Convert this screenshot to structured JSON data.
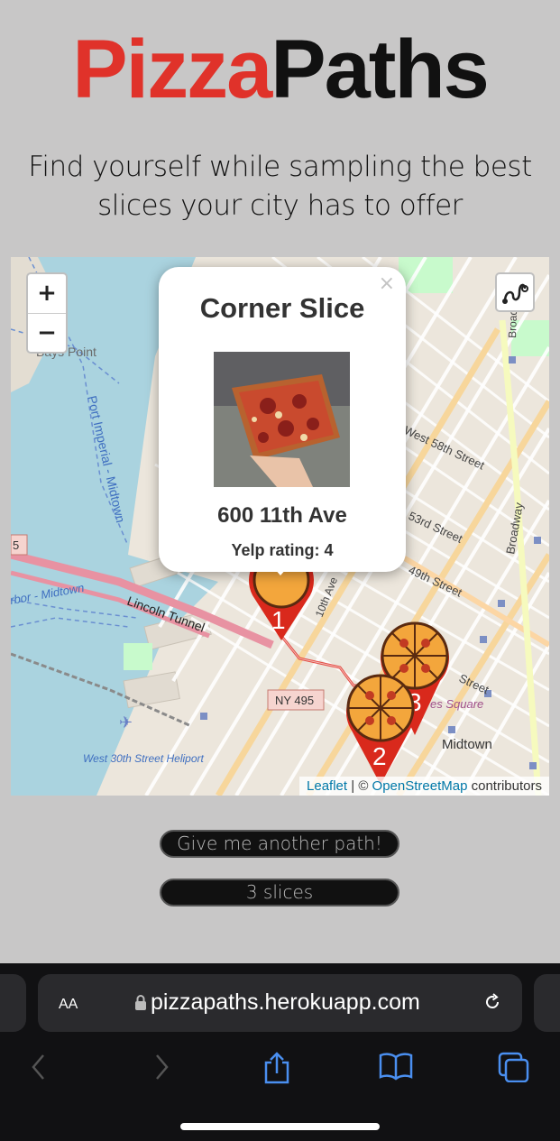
{
  "header": {
    "title_part1": "Pizza",
    "title_part2": "Paths",
    "tagline": "Find yourself while sampling the best slices your city has to offer"
  },
  "map": {
    "zoom_in": "+",
    "zoom_out": "−",
    "labels": {
      "port_imperial": "Port Imperial - Midtown",
      "bays_point": "Bays Point",
      "lincoln_tunnel": "Lincoln Tunnel",
      "ny495": "NY 495",
      "west_58th": "West 58th Street",
      "w53rd": "53rd Street",
      "w49th": "49th Street",
      "broadway": "Broadway",
      "broad": "Broad",
      "midtown": "Midtown",
      "times_square": "es Square",
      "heliport": "West 30th Street Heliport",
      "harbor": "rbor - Midtown",
      "tenth_ave": "10th Ave",
      "street_frag": "Street",
      "num5": "5"
    },
    "markers": [
      "1",
      "2",
      "3"
    ],
    "popup": {
      "close": "×",
      "name": "Corner Slice",
      "address": "600 11th Ave",
      "rating": "Yelp rating: 4"
    },
    "attribution": {
      "leaflet": "Leaflet",
      "sep": "| © ",
      "osm": "OpenStreetMap",
      "contrib": " contributors"
    }
  },
  "buttons": {
    "another_path": "Give me another path!",
    "slices": "3 slices"
  },
  "browser": {
    "aa_label": "AA",
    "url": "pizzapaths.herokuapp.com"
  },
  "colors": {
    "brand_red": "#e0322a",
    "marker_red": "#d9291c",
    "water": "#aad3df",
    "link": "#0078a8"
  }
}
